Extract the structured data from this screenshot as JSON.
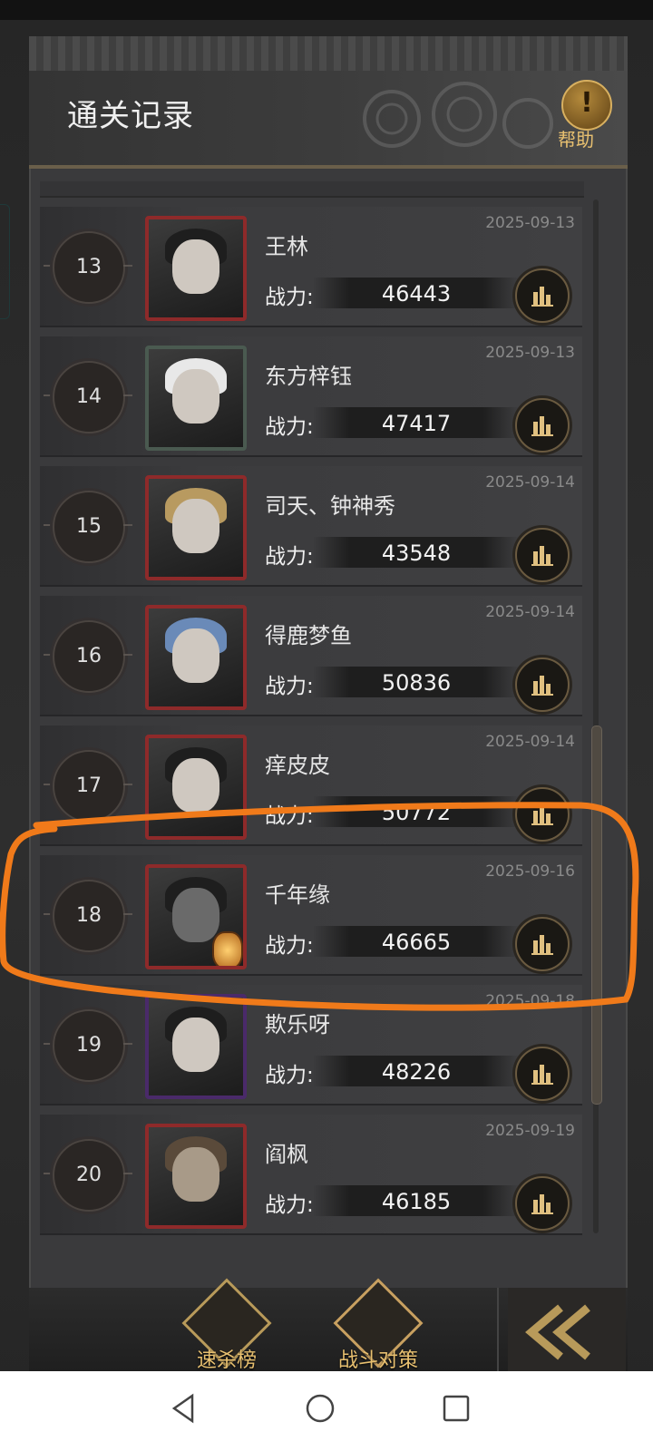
{
  "header": {
    "title": "通关记录",
    "help_label": "帮助",
    "help_mark": "!"
  },
  "records": [
    {
      "rank": "13",
      "name": "王林",
      "date": "2025-09-13",
      "power_label": "战力:",
      "power": "46443"
    },
    {
      "rank": "14",
      "name": "东方梓钰",
      "date": "2025-09-13",
      "power_label": "战力:",
      "power": "47417"
    },
    {
      "rank": "15",
      "name": "司天、钟神秀",
      "date": "2025-09-14",
      "power_label": "战力:",
      "power": "43548"
    },
    {
      "rank": "16",
      "name": "得鹿梦鱼",
      "date": "2025-09-14",
      "power_label": "战力:",
      "power": "50836"
    },
    {
      "rank": "17",
      "name": "痒皮皮",
      "date": "2025-09-14",
      "power_label": "战力:",
      "power": "50772"
    },
    {
      "rank": "18",
      "name": "千年缘",
      "date": "2025-09-16",
      "power_label": "战力:",
      "power": "46665"
    },
    {
      "rank": "19",
      "name": "欺乐呀",
      "date": "2025-09-18",
      "power_label": "战力:",
      "power": "48226"
    },
    {
      "rank": "20",
      "name": "阎枫",
      "date": "2025-09-19",
      "power_label": "战力:",
      "power": "46185"
    }
  ],
  "bottom_tabs": {
    "speed_rank": "速杀榜",
    "battle_strategy": "战斗对策"
  },
  "colors": {
    "highlight": "#f07a1a",
    "accent_gold": "#e8c070"
  },
  "icons": {
    "help": "exclamation-badge-icon",
    "stats": "bar-chart-icon",
    "back": "double-chevron-left-icon",
    "nav_back": "triangle-back-icon",
    "nav_home": "circle-home-icon",
    "nav_recents": "square-recents-icon"
  }
}
